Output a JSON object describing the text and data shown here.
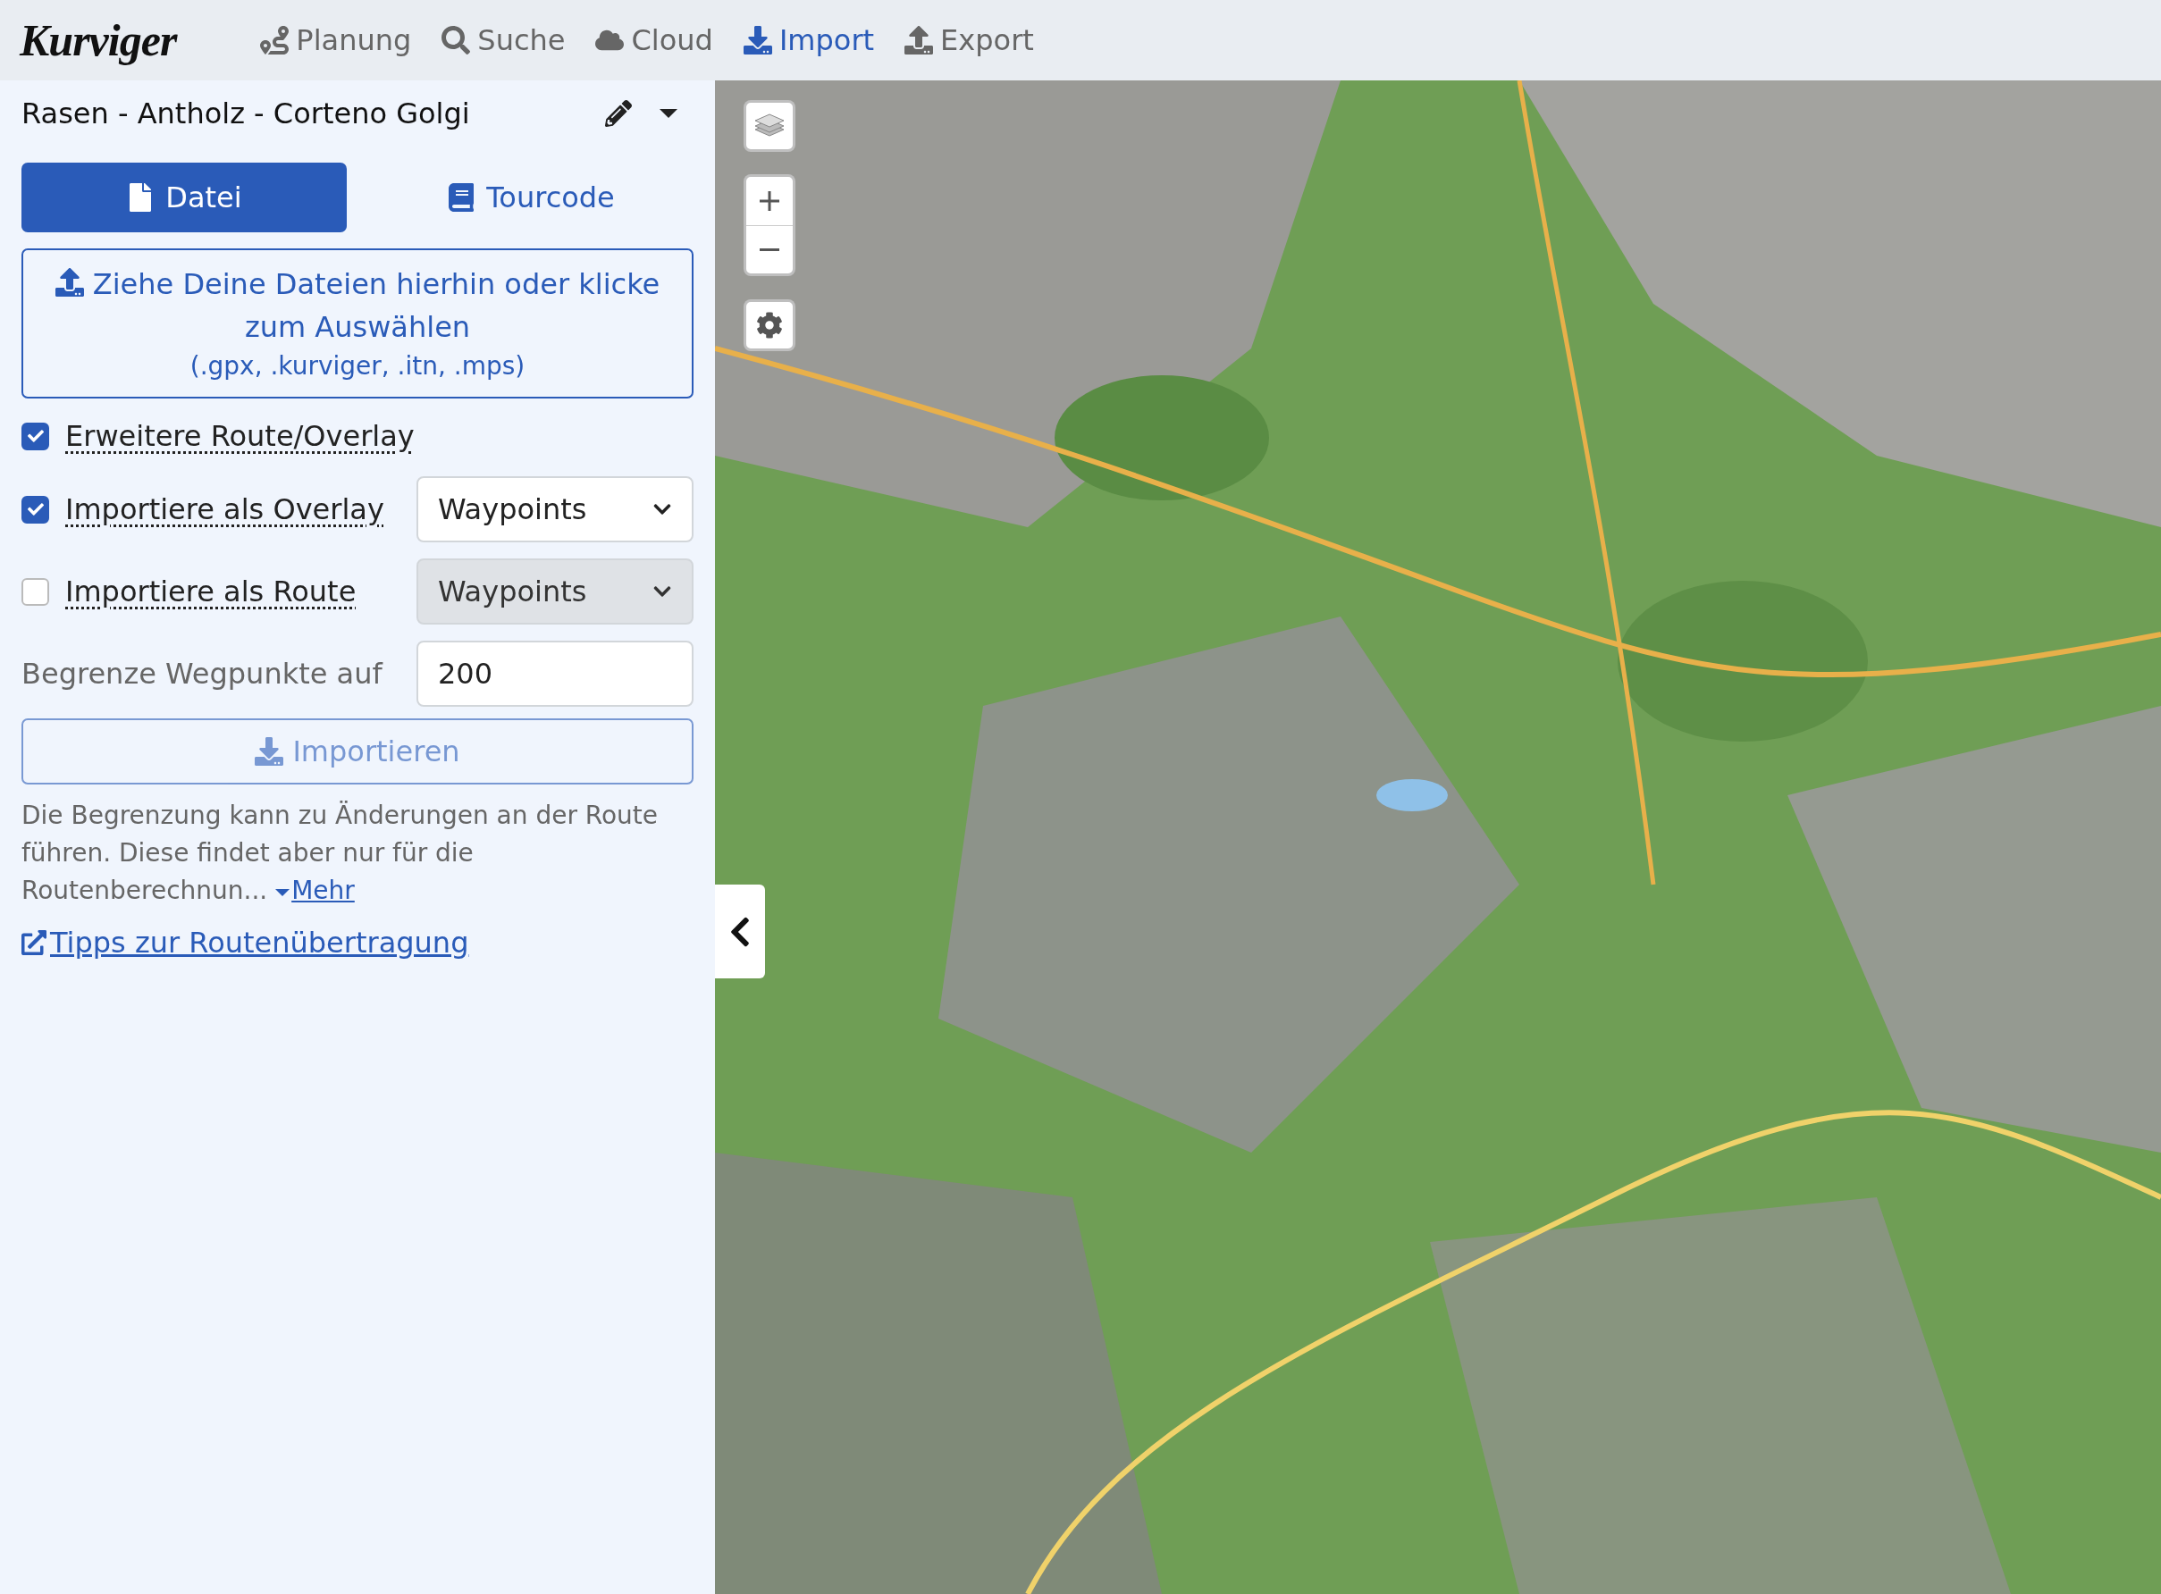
{
  "logo": "Kurviger",
  "nav": [
    {
      "label": "Planung",
      "selected": false
    },
    {
      "label": "Suche",
      "selected": false
    },
    {
      "label": "Cloud",
      "selected": false
    },
    {
      "label": "Import",
      "selected": true
    },
    {
      "label": "Export",
      "selected": false
    }
  ],
  "title": "Rasen - Antholz - Corteno Golgi",
  "tabs": [
    {
      "label": "Datei",
      "selected": true
    },
    {
      "label": "Tourcode",
      "selected": false
    }
  ],
  "dropzone": {
    "text": "Ziehe Deine Dateien hierhin oder klicke zum Auswählen",
    "extensions": "(.gpx, .kurviger, .itn, .mps)"
  },
  "options": [
    {
      "kind": "checkbox",
      "label": "Erweitere Route/Overlay",
      "checked": true
    },
    {
      "kind": "checkbox-select",
      "label": "Importiere als Overlay",
      "checked": true,
      "select": {
        "value": "Waypoints",
        "disabled": false
      }
    },
    {
      "kind": "checkbox-select",
      "label": "Importiere als Route",
      "checked": false,
      "select": {
        "value": "Waypoints",
        "disabled": true
      }
    }
  ],
  "limit": {
    "label": "Begrenze Wegpunkte auf",
    "value": "200"
  },
  "import_button": {
    "label": "Importieren",
    "disabled": true
  },
  "help": {
    "text": "Die Begrenzung kann zu Änderungen an der Route führen. Diese findet aber nur für die Routenberechnun...",
    "more": "Mehr"
  },
  "tips_link": "Tipps zur Routenübertragung"
}
